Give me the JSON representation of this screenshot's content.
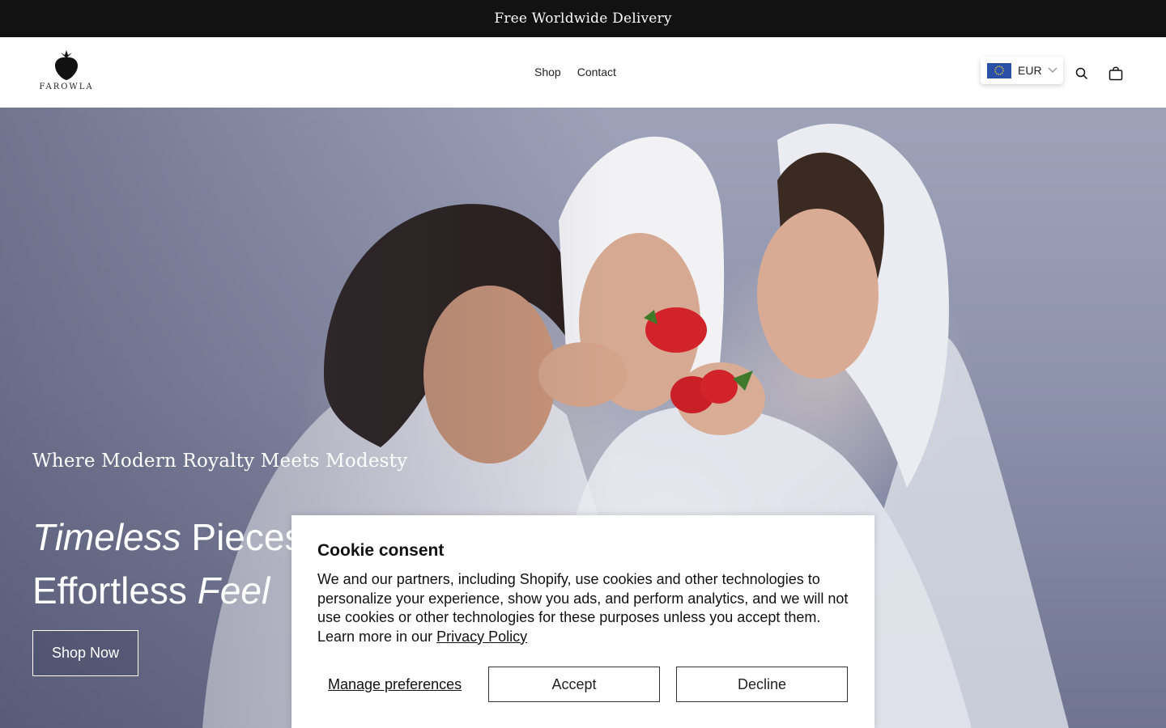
{
  "announcement": {
    "text": "Free Worldwide Delivery"
  },
  "header": {
    "logo_text": "FAROWLA",
    "nav": [
      {
        "label": "Shop"
      },
      {
        "label": "Contact"
      }
    ],
    "currency": {
      "code": "EUR",
      "flag": "eu-flag-icon"
    },
    "icons": {
      "search": "search-icon",
      "cart": "shopping-bag-icon"
    }
  },
  "hero": {
    "tagline": "Where Modern Royalty Meets Modesty",
    "headline": {
      "line1_italic": "Timeless",
      "line1_rest": " Pieces",
      "line2_rest": "Effortless ",
      "line2_italic": "Feel"
    },
    "cta_label": "Shop Now"
  },
  "cookie": {
    "title": "Cookie consent",
    "body": "We and our partners, including Shopify, use cookies and other technologies to personalize your experience, show you ads, and perform analytics, and we will not use cookies or other technologies for these purposes unless you accept them. Learn more in our ",
    "link_text": "Privacy Policy",
    "manage_label": "Manage preferences",
    "accept_label": "Accept",
    "decline_label": "Decline"
  },
  "colors": {
    "announcement_bg": "#121212",
    "strawberry": "#d2232a"
  }
}
